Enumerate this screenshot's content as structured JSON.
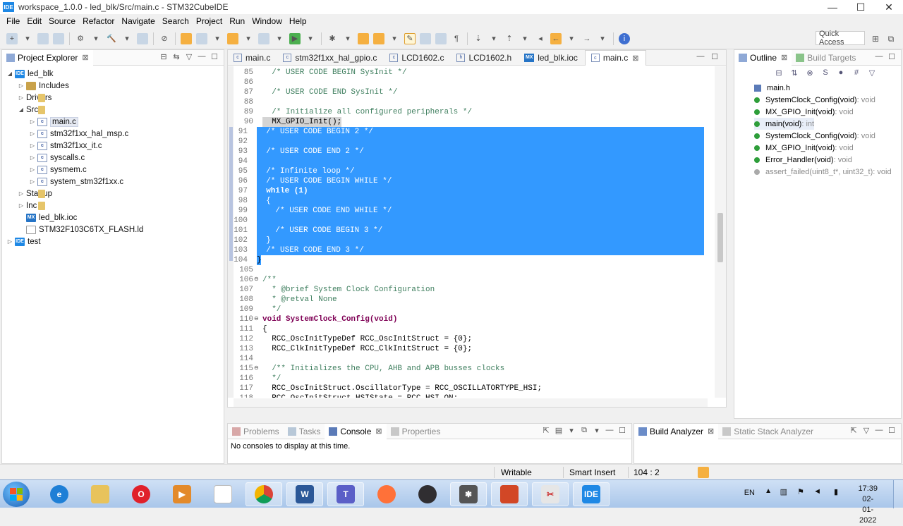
{
  "window": {
    "title": "workspace_1.0.0 - led_blk/Src/main.c - STM32CubeIDE",
    "logo": "IDE"
  },
  "menu": [
    "File",
    "Edit",
    "Source",
    "Refactor",
    "Navigate",
    "Search",
    "Project",
    "Run",
    "Window",
    "Help"
  ],
  "toolbar": {
    "quick_access": "Quick Access"
  },
  "explorer": {
    "tab_label": "Project Explorer",
    "items": [
      {
        "label": "led_blk",
        "icon": "ide-project-icon"
      },
      {
        "label": "Includes",
        "icon": "includes-icon"
      },
      {
        "label": "Drivers",
        "icon": "folder-icon"
      },
      {
        "label": "Src",
        "icon": "folder-icon"
      },
      {
        "label": "main.c",
        "icon": "c-file-icon"
      },
      {
        "label": "stm32f1xx_hal_msp.c",
        "icon": "c-file-icon"
      },
      {
        "label": "stm32f1xx_it.c",
        "icon": "c-file-icon"
      },
      {
        "label": "syscalls.c",
        "icon": "c-file-icon"
      },
      {
        "label": "sysmem.c",
        "icon": "c-file-icon"
      },
      {
        "label": "system_stm32f1xx.c",
        "icon": "c-file-icon"
      },
      {
        "label": "Startup",
        "icon": "folder-icon"
      },
      {
        "label": "Inc",
        "icon": "folder-icon"
      },
      {
        "label": "led_blk.ioc",
        "icon": "mx-file-icon"
      },
      {
        "label": "STM32F103C6TX_FLASH.ld",
        "icon": "ld-file-icon"
      },
      {
        "label": "test",
        "icon": "ide-project-icon"
      }
    ]
  },
  "editor": {
    "tabs": [
      "main.c",
      "stm32f1xx_hal_gpio.c",
      "LCD1602.c",
      "LCD1602.h",
      "led_blk.ioc",
      "main.c"
    ],
    "lines": [
      {
        "n": "85",
        "t": "  /* USER CODE BEGIN SysInit */"
      },
      {
        "n": "86",
        "t": ""
      },
      {
        "n": "87",
        "t": "  /* USER CODE END SysInit */"
      },
      {
        "n": "88",
        "t": ""
      },
      {
        "n": "89",
        "t": "  /* Initialize all configured peripherals */"
      },
      {
        "n": "90",
        "t": "  MX_GPIO_Init();"
      },
      {
        "n": "91",
        "t": "  /* USER CODE BEGIN 2 */"
      },
      {
        "n": "92",
        "t": ""
      },
      {
        "n": "93",
        "t": "  /* USER CODE END 2 */"
      },
      {
        "n": "94",
        "t": ""
      },
      {
        "n": "95",
        "t": "  /* Infinite loop */"
      },
      {
        "n": "96",
        "t": "  /* USER CODE BEGIN WHILE */"
      },
      {
        "n": "97",
        "t": "  while (1)"
      },
      {
        "n": "98",
        "t": "  {"
      },
      {
        "n": "99",
        "t": "    /* USER CODE END WHILE */"
      },
      {
        "n": "100",
        "t": ""
      },
      {
        "n": "101",
        "t": "    /* USER CODE BEGIN 3 */"
      },
      {
        "n": "102",
        "t": "  }"
      },
      {
        "n": "103",
        "t": "  /* USER CODE END 3 */"
      },
      {
        "n": "104",
        "t": "}"
      },
      {
        "n": "105",
        "t": ""
      },
      {
        "n": "106",
        "t": "/**"
      },
      {
        "n": "107",
        "t": "  * @brief System Clock Configuration"
      },
      {
        "n": "108",
        "t": "  * @retval None"
      },
      {
        "n": "109",
        "t": "  */"
      },
      {
        "n": "110",
        "t": "void SystemClock_Config(void)"
      },
      {
        "n": "111",
        "t": "{"
      },
      {
        "n": "112",
        "t": "  RCC_OscInitTypeDef RCC_OscInitStruct = {0};"
      },
      {
        "n": "113",
        "t": "  RCC_ClkInitTypeDef RCC_ClkInitStruct = {0};"
      },
      {
        "n": "114",
        "t": ""
      },
      {
        "n": "115",
        "t": "  /** Initializes the CPU, AHB and APB busses clocks"
      },
      {
        "n": "116",
        "t": "  */"
      },
      {
        "n": "117",
        "t": "  RCC_OscInitStruct.OscillatorType = RCC_OSCILLATORTYPE_HSI;"
      },
      {
        "n": "118",
        "t": "  RCC_OscInitStruct.HSIState = RCC_HSI_ON;"
      }
    ]
  },
  "outline": {
    "tabs": [
      "Outline",
      "Build Targets"
    ],
    "items": [
      {
        "name": "main.h",
        "type": ""
      },
      {
        "name": "SystemClock_Config(void)",
        "type": " : void"
      },
      {
        "name": "MX_GPIO_Init(void)",
        "type": " : void"
      },
      {
        "name": "main(void)",
        "type": " : int"
      },
      {
        "name": "SystemClock_Config(void)",
        "type": " : void"
      },
      {
        "name": "MX_GPIO_Init(void)",
        "type": " : void"
      },
      {
        "name": "Error_Handler(void)",
        "type": " : void"
      },
      {
        "name": "assert_failed(uint8_t*, uint32_t)",
        "type": " : void"
      }
    ]
  },
  "console_panel": {
    "tabs": [
      "Problems",
      "Tasks",
      "Console",
      "Properties"
    ],
    "message": "No consoles to display at this time."
  },
  "build_panel": {
    "tabs": [
      "Build Analyzer",
      "Static Stack Analyzer"
    ]
  },
  "status": {
    "writable": "Writable",
    "insert_mode": "Smart Insert",
    "position": "104 : 2"
  },
  "taskbar": {
    "lang": "EN",
    "time": "17:39",
    "date": "02-01-2022",
    "ide_label": "IDE"
  },
  "colors": {
    "selection": "#3399ff",
    "comment": "#3f7f5f",
    "keyword": "#7f0055",
    "accent": "#1e88e5"
  }
}
